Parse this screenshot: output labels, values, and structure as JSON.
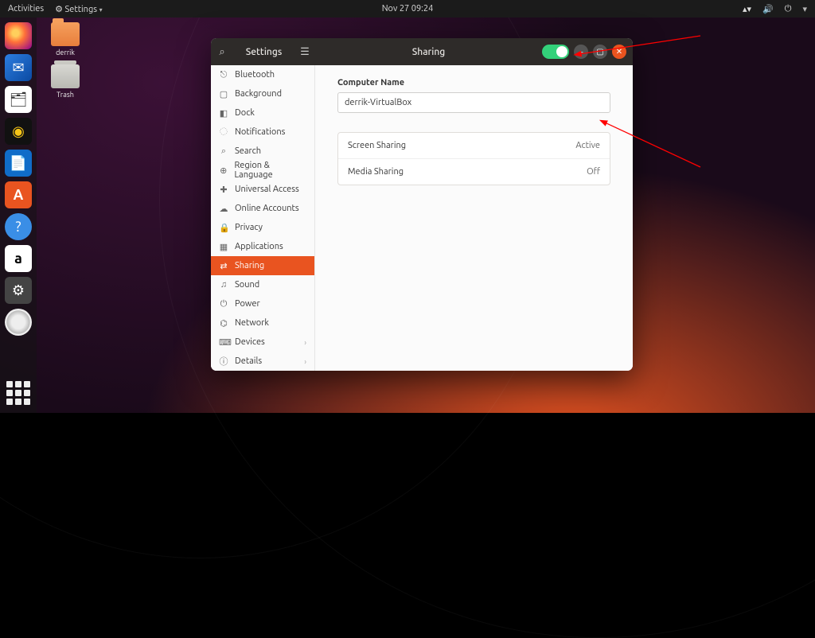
{
  "panel": {
    "activities": "Activities",
    "app_indicator": "Settings",
    "clock": "Nov 27  09:24"
  },
  "desktop": {
    "home_folder": "derrik",
    "trash": "Trash"
  },
  "window": {
    "sidebar_title": "Settings",
    "header_title": "Sharing",
    "sidebar": [
      {
        "icon": "⎋",
        "label": "Bluetooth"
      },
      {
        "icon": "▢",
        "label": "Background"
      },
      {
        "icon": "◧",
        "label": "Dock"
      },
      {
        "icon": "◌",
        "label": "Notifications"
      },
      {
        "icon": "⌕",
        "label": "Search"
      },
      {
        "icon": "⊕",
        "label": "Region & Language"
      },
      {
        "icon": "✚",
        "label": "Universal Access"
      },
      {
        "icon": "☁",
        "label": "Online Accounts"
      },
      {
        "icon": "🔒",
        "label": "Privacy"
      },
      {
        "icon": "▦",
        "label": "Applications"
      },
      {
        "icon": "⇄",
        "label": "Sharing",
        "active": true
      },
      {
        "icon": "♫",
        "label": "Sound"
      },
      {
        "icon": "⏻",
        "label": "Power"
      },
      {
        "icon": "⌬",
        "label": "Network"
      },
      {
        "icon": "⌨",
        "label": "Devices",
        "chevron": true
      },
      {
        "icon": "ⓘ",
        "label": "Details",
        "chevron": true
      }
    ],
    "content": {
      "computer_name_label": "Computer Name",
      "computer_name_value": "derrik-VirtualBox",
      "rows": [
        {
          "label": "Screen Sharing",
          "status": "Active"
        },
        {
          "label": "Media Sharing",
          "status": "Off"
        }
      ]
    }
  }
}
